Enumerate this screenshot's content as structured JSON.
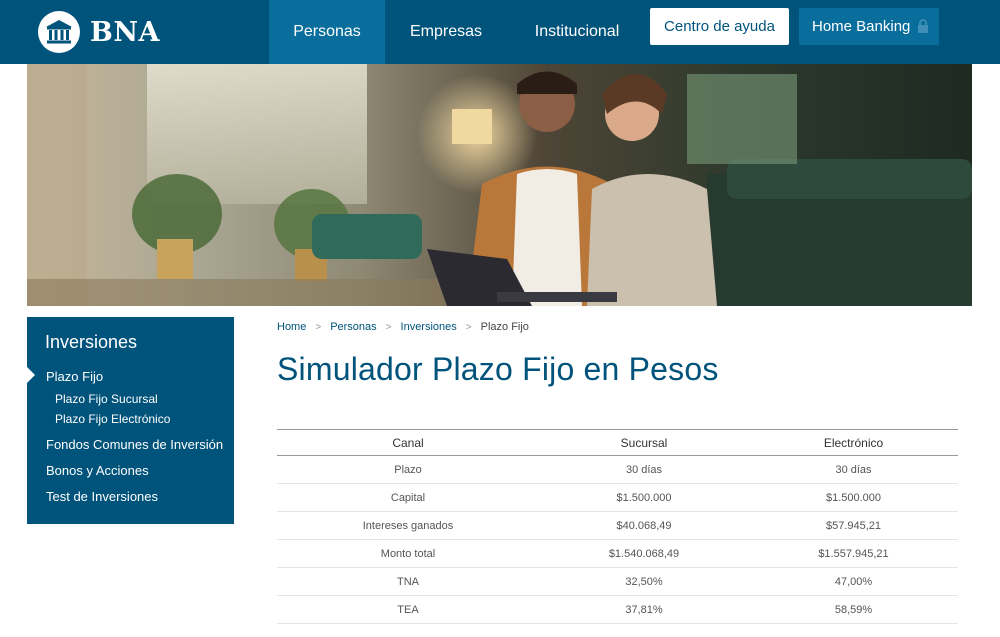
{
  "brand": {
    "name": "BNA"
  },
  "nav": {
    "items": [
      {
        "label": "Personas",
        "active": true
      },
      {
        "label": "Empresas",
        "active": false
      },
      {
        "label": "Institucional",
        "active": false
      }
    ],
    "help_button": "Centro de ayuda",
    "home_banking": "Home Banking"
  },
  "sidebar": {
    "title": "Inversiones",
    "items": [
      {
        "label": "Plazo Fijo",
        "active": true
      },
      {
        "label": "Plazo Fijo Sucursal"
      },
      {
        "label": "Plazo Fijo Electrónico"
      },
      {
        "label": "Fondos Comunes de Inversión"
      },
      {
        "label": "Bonos y Acciones"
      },
      {
        "label": "Test de Inversiones"
      }
    ]
  },
  "breadcrumb": [
    "Home",
    "Personas",
    "Inversiones",
    "Plazo Fijo"
  ],
  "page_title": "Simulador Plazo Fijo en Pesos",
  "table": {
    "headers": [
      "Canal",
      "Sucursal",
      "Electrónico"
    ],
    "rows": [
      [
        "Plazo",
        "30 días",
        "30 días"
      ],
      [
        "Capital",
        "$1.500.000",
        "$1.500.000"
      ],
      [
        "Intereses ganados",
        "$40.068,49",
        "$57.945,21"
      ],
      [
        "Monto total",
        "$1.540.068,49",
        "$1.557.945,21"
      ],
      [
        "TNA",
        "32,50%",
        "47,00%"
      ],
      [
        "TEA",
        "37,81%",
        "58,59%"
      ]
    ]
  },
  "colors": {
    "brand_blue": "#00537b",
    "active_blue": "#0a6e9c"
  },
  "icons": {
    "logo": "bank-building-icon",
    "lock": "lock-icon",
    "separator": "chevron-right-icon"
  }
}
